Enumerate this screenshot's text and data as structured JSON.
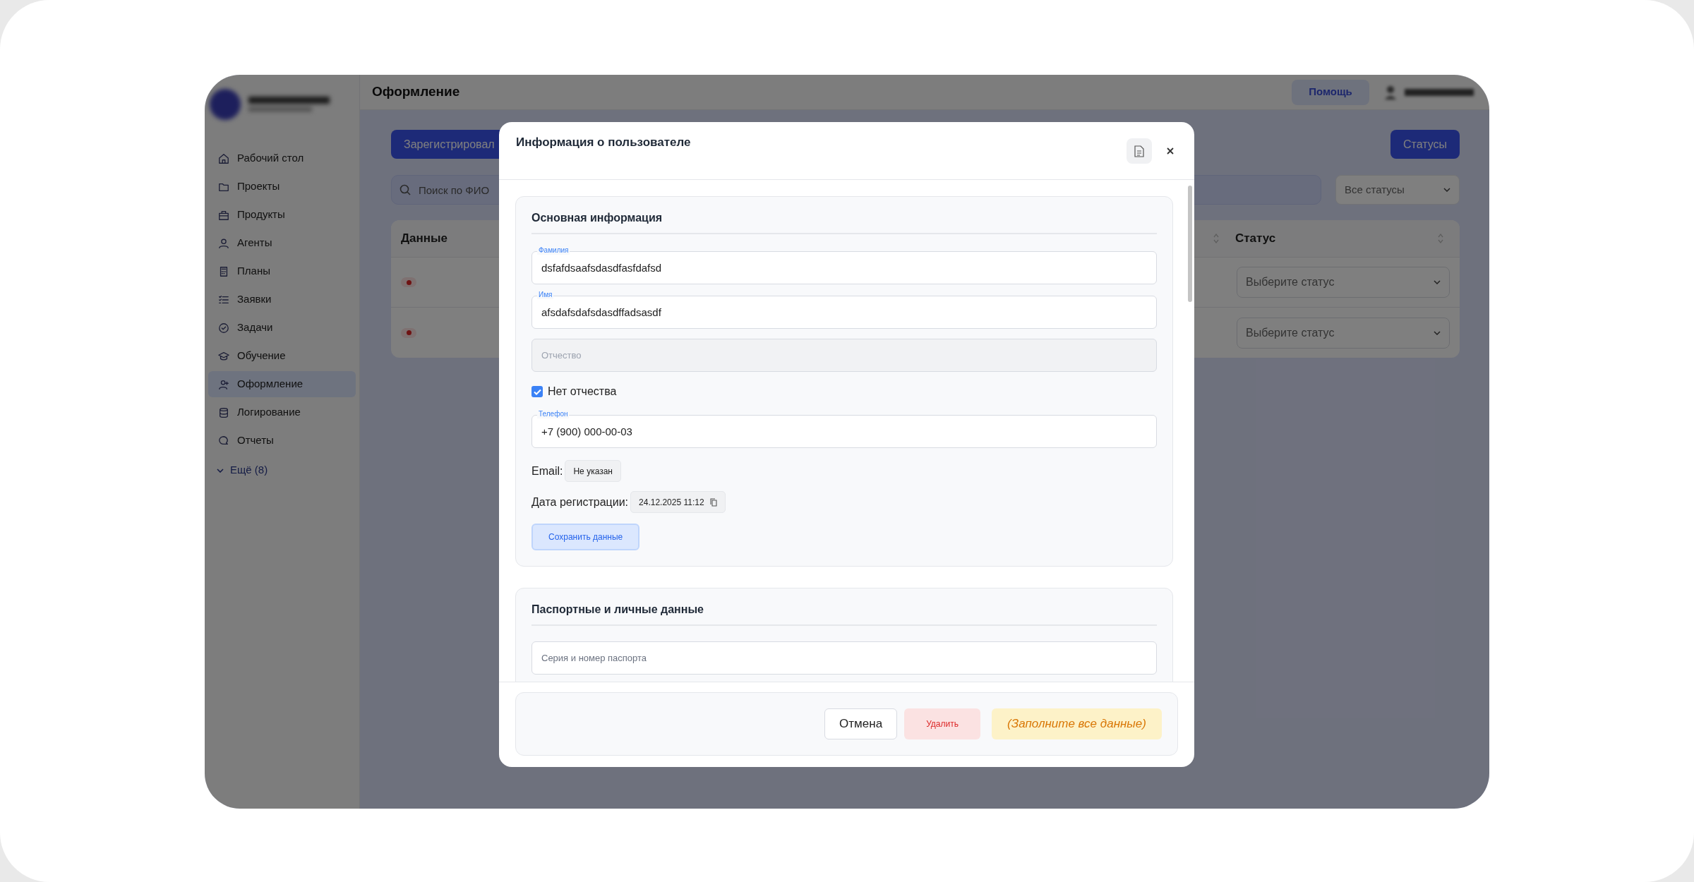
{
  "header": {
    "title": "Оформление",
    "help_button": "Помощь"
  },
  "sidebar": {
    "items": [
      {
        "label": "Рабочий стол",
        "selected": false
      },
      {
        "label": "Проекты",
        "selected": false
      },
      {
        "label": "Продукты",
        "selected": false
      },
      {
        "label": "Агенты",
        "selected": false
      },
      {
        "label": "Планы",
        "selected": false
      },
      {
        "label": "Заявки",
        "selected": false
      },
      {
        "label": "Задачи",
        "selected": false
      },
      {
        "label": "Обучение",
        "selected": false
      },
      {
        "label": "Оформление",
        "selected": true
      },
      {
        "label": "Логирование",
        "selected": false
      },
      {
        "label": "Отчеты",
        "selected": false
      }
    ],
    "more": "Ещё (8)"
  },
  "toolbar": {
    "register_button": "Зарегистрировал",
    "statuses_button": "Статусы",
    "search": {
      "placeholder": "Поиск по ФИО"
    },
    "status_filter": "Все статусы"
  },
  "table": {
    "columns": [
      "Данные",
      "Статус"
    ],
    "rows": [
      {
        "status": {
          "placeholder": "Выберите статус"
        }
      },
      {
        "status": {
          "placeholder": "Выберите статус"
        }
      }
    ]
  },
  "modal": {
    "title": "Информация о пользователе",
    "sections": [
      {
        "title": "Основная информация",
        "fields": [
          {
            "kind": "field",
            "label": "Фамилия",
            "value": "dsfafdsaafsdasdfasfdafsd",
            "disabled": false
          },
          {
            "kind": "field",
            "label": "Имя",
            "value": "afsdafsdafsdasdffadsasdf",
            "disabled": false
          },
          {
            "kind": "field",
            "placeholder": "Отчество",
            "disabled": true
          },
          {
            "kind": "checkbox",
            "label": "Нет отчества",
            "checked": true
          },
          {
            "kind": "field",
            "label": "Телефон",
            "value": "+7 (900) 000-00-03",
            "disabled": false
          },
          {
            "kind": "info",
            "label": "Email:",
            "value": "Не указан",
            "copyable": false
          },
          {
            "kind": "info",
            "label": "Дата регистрации:",
            "value": "24.12.2025 11:12",
            "copyable": true
          },
          {
            "kind": "button",
            "label": "Сохранить данные"
          }
        ]
      },
      {
        "title": "Паспортные и личные данные",
        "fields": [
          {
            "kind": "field",
            "placeholder": "Серия и номер паспорта",
            "disabled": false
          }
        ]
      }
    ],
    "footer": [
      {
        "kind": "secondary",
        "label": "Отмена"
      },
      {
        "kind": "danger",
        "label": "Удалить"
      },
      {
        "kind": "warning",
        "label": "(Заполните все данные)"
      }
    ]
  }
}
